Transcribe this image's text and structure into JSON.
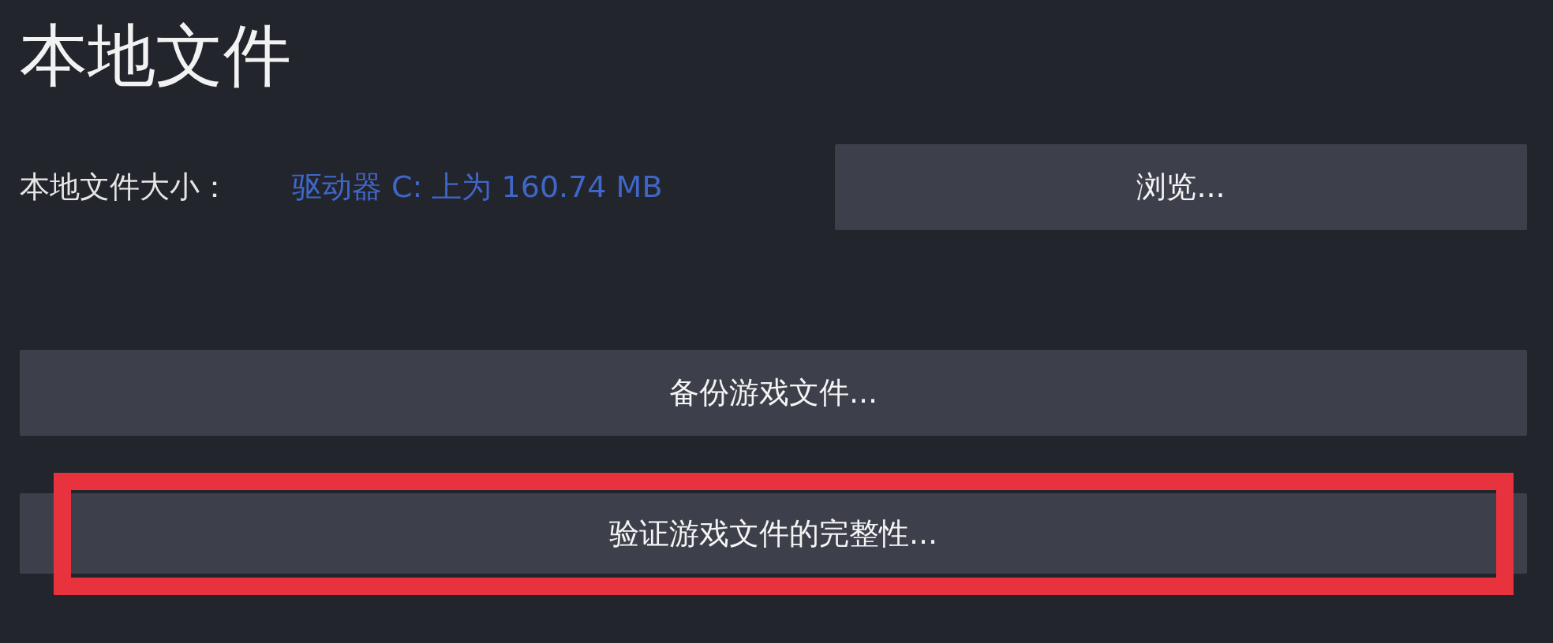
{
  "title": "本地文件",
  "size_row": {
    "label": "本地文件大小：",
    "value": "驱动器 C: 上为 160.74 MB"
  },
  "buttons": [
    {
      "kind": "browse",
      "label": "浏览...",
      "highlighted": false
    },
    {
      "kind": "wide",
      "label": "备份游戏文件...",
      "highlighted": false
    },
    {
      "kind": "wide",
      "label": "验证游戏文件的完整性...",
      "highlighted": true
    }
  ]
}
